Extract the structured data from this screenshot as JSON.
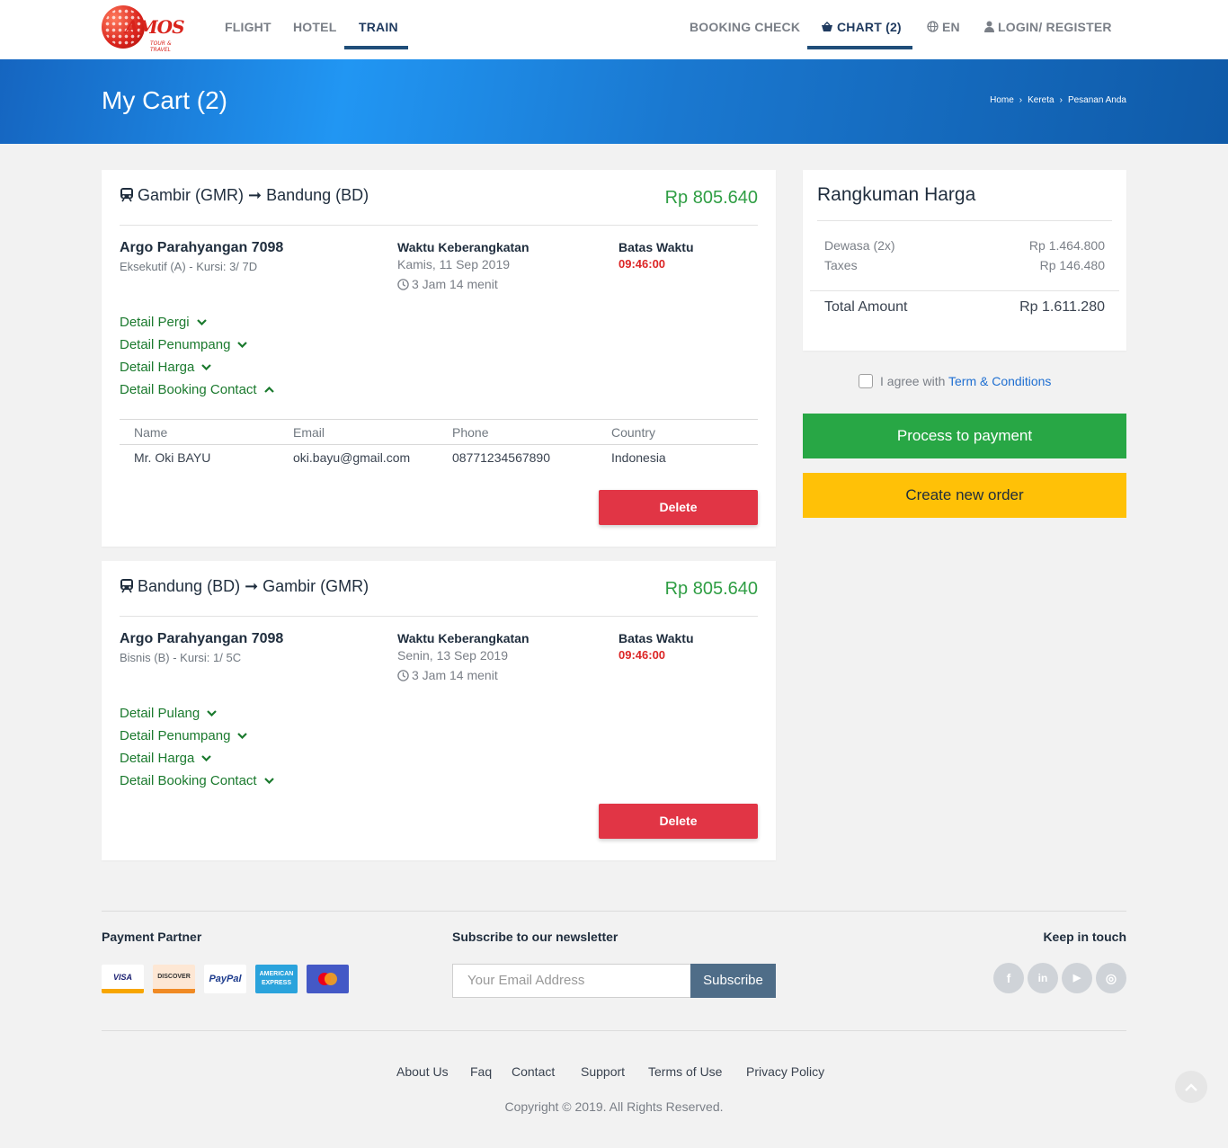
{
  "header": {
    "logo_text": "AMOS",
    "logo_tagline": "TOUR & TRAVEL",
    "nav": {
      "flight": "FLIGHT",
      "hotel": "HOTEL",
      "train": "TRAIN"
    },
    "booking_check": "BOOKING CHECK",
    "chart": "CHART (2)",
    "language": "EN",
    "login": "LOGIN/ REGISTER"
  },
  "banner": {
    "title": "My Cart (2)",
    "breadcrumb": [
      "Home",
      "Kereta",
      "Pesanan Anda"
    ]
  },
  "orders": [
    {
      "route": "Gambir (GMR) ➞ Bandung (BD)",
      "price": "Rp 805.640",
      "train": "Argo Parahyangan 7098",
      "class": "Eksekutif (A) - Kursi: 3/ 7D",
      "departure_label": "Waktu Keberangkatan",
      "departure_date": "Kamis, 11 Sep 2019",
      "duration": "3 Jam 14 menit",
      "deadline_label": "Batas Waktu",
      "deadline": "09:46:00",
      "details": [
        "Detail Pergi",
        "Detail Penumpang",
        "Detail Harga",
        "Detail Booking Contact"
      ],
      "contact_headers": [
        "Name",
        "Email",
        "Phone",
        "Country"
      ],
      "contact": [
        "Mr. Oki BAYU",
        "oki.bayu@gmail.com",
        "08771234567890",
        "Indonesia"
      ],
      "delete": "Delete"
    },
    {
      "route": "Bandung (BD) ➞ Gambir (GMR)",
      "price": "Rp 805.640",
      "train": "Argo Parahyangan 7098",
      "class": "Bisnis (B) - Kursi: 1/ 5C",
      "departure_label": "Waktu Keberangkatan",
      "departure_date": "Senin, 13 Sep 2019",
      "duration": "3 Jam 14 menit",
      "deadline_label": "Batas Waktu",
      "deadline": "09:46:00",
      "details": [
        "Detail Pulang",
        "Detail Penumpang",
        "Detail Harga",
        "Detail Booking Contact"
      ],
      "delete": "Delete"
    }
  ],
  "summary": {
    "title": "Rangkuman Harga",
    "lines": [
      {
        "label": "Dewasa (2x)",
        "value": "Rp 1.464.800"
      },
      {
        "label": "Taxes",
        "value": "Rp 146.480"
      }
    ],
    "total_label": "Total Amount",
    "total_value": "Rp 1.611.280"
  },
  "agree": {
    "text": "I agree with ",
    "link": "Term & Conditions"
  },
  "buttons": {
    "pay": "Process to payment",
    "new_order": "Create new order"
  },
  "colors": {
    "primary_blue": "#2196f3",
    "green": "#28a745",
    "yellow": "#ffc107",
    "red": "#e13545"
  },
  "footer": {
    "payment_title": "Payment Partner",
    "payments": [
      "VISA",
      "DISCOVER",
      "PayPal",
      "AMERICAN EXPRESS",
      "mastercard"
    ],
    "newsletter_title": "Subscribe to our newsletter",
    "email_placeholder": "Your Email Address",
    "subscribe": "Subscribe",
    "keep_title": "Keep in touch",
    "social": [
      "f",
      "in",
      "▶",
      "◎"
    ],
    "links": [
      "About Us",
      "Faq",
      "Contact",
      "Support",
      "Terms of Use",
      "Privacy Policy"
    ],
    "copyright": "Copyright © 2019. All Rights Reserved."
  }
}
